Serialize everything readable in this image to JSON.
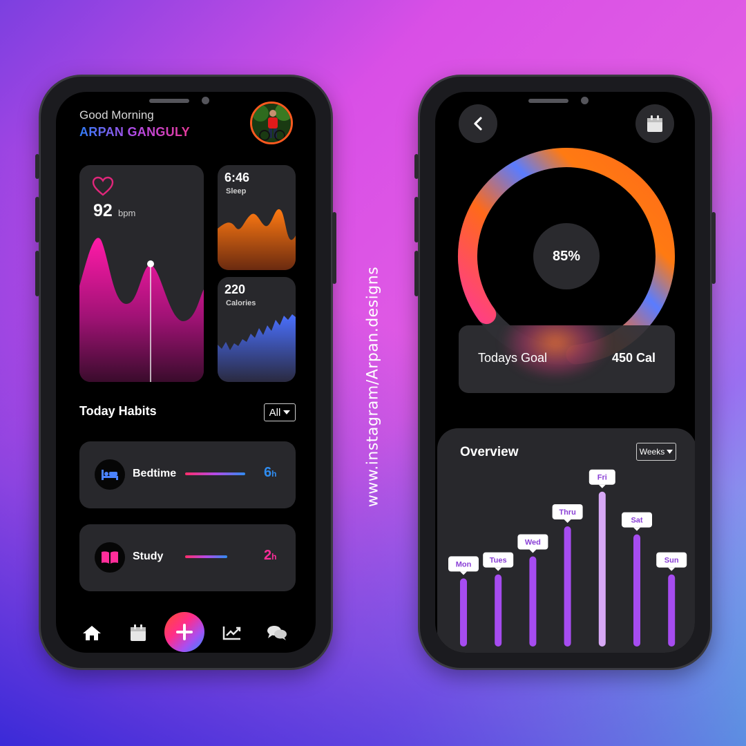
{
  "caption": "www.instagram/Arpan.designs",
  "left_screen": {
    "greeting": "Good Morning",
    "user_name": "ARPAN GANGULY",
    "heart": {
      "value": "92",
      "unit": "bpm",
      "icon": "heart-icon"
    },
    "sleep": {
      "value": "6:46",
      "label": "Sleep"
    },
    "calories": {
      "value": "220",
      "label": "Calories"
    },
    "habits_title": "Today Habits",
    "filter": {
      "selected": "All"
    },
    "habits": [
      {
        "label": "Bedtime",
        "value": "6",
        "unit": "h",
        "icon": "bed-icon",
        "color": "#2f8cf0",
        "progress": 1.0
      },
      {
        "label": "Study",
        "value": "2",
        "unit": "h",
        "icon": "book-icon",
        "color": "#ff2d9a",
        "progress": 0.7
      }
    ],
    "nav": [
      {
        "name": "home-icon"
      },
      {
        "name": "calendar-icon"
      },
      {
        "name": "add-icon"
      },
      {
        "name": "chart-icon"
      },
      {
        "name": "chat-icon"
      }
    ]
  },
  "right_screen": {
    "percent": "85%",
    "progress_fraction": 0.85,
    "goal_label": "Todays Goal",
    "goal_value": "450 Cal",
    "overview_title": "Overview",
    "period": {
      "selected": "Weeks"
    },
    "colors": {
      "bar": "#a64cf0",
      "highlight": "#d7a8f5",
      "accent_orange": "#ff6a1a",
      "accent_pink": "#ff2db0",
      "accent_blue": "#5a7cff"
    }
  },
  "chart_data": {
    "type": "bar",
    "categories": [
      "Mon",
      "Tues",
      "Wed",
      "Thru",
      "Fri",
      "Sat",
      "Sun"
    ],
    "values": [
      102,
      108,
      135,
      180,
      232,
      168,
      108
    ],
    "highlight": "Fri"
  }
}
